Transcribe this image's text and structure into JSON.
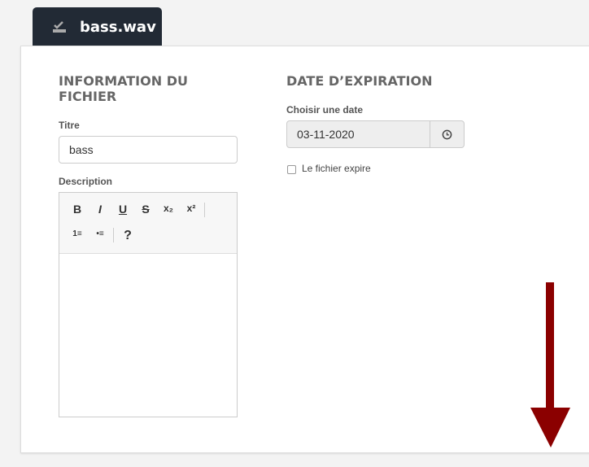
{
  "tab": {
    "title": "bass.wav",
    "icon": "download-check-icon"
  },
  "file_info": {
    "heading_line1": "INFORMATION DU",
    "heading_line2": "FICHIER",
    "title_label": "Titre",
    "title_value": "bass",
    "description_label": "Description",
    "toolbar": {
      "bold": "B",
      "italic": "I",
      "underline": "U",
      "strike": "S",
      "subscript": "x₂",
      "superscript": "x²",
      "ordered_list": "1≡",
      "unordered_list": "•≡",
      "help": "?"
    }
  },
  "expiration": {
    "heading": "DATE D’EXPIRATION",
    "date_label": "Choisir une date",
    "date_value": "03-11-2020",
    "checkbox_label": "Le fichier expire",
    "checkbox_checked": false
  },
  "annotation": {
    "arrow_color": "#8b0000",
    "direction": "down"
  }
}
